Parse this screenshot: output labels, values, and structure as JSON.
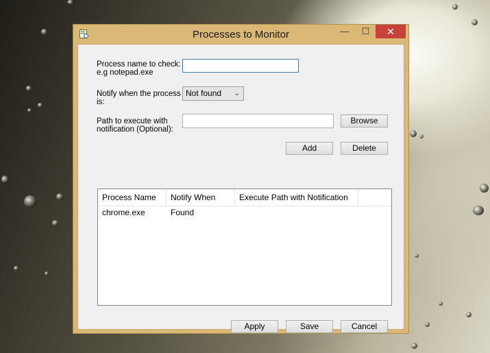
{
  "window": {
    "title": "Processes to Monitor",
    "controls": {
      "minimize": "—",
      "maximize": "☐",
      "close": "✕"
    }
  },
  "form": {
    "process_label": "Process name to check:",
    "process_hint": "e.g notepad.exe",
    "process_value": "",
    "notify_label_line1": "Notify when the process",
    "notify_label_line2": "is:",
    "notify_selected": "Not found",
    "path_label_line1": "Path to execute with",
    "path_label_line2": "notification (Optional):",
    "path_value": "",
    "browse_label": "Browse",
    "add_label": "Add",
    "delete_label": "Delete"
  },
  "list": {
    "columns": [
      "Process Name",
      "Notify When",
      "Execute Path with Notification"
    ],
    "rows": [
      {
        "process": "chrome.exe",
        "notify": "Found",
        "path": ""
      }
    ]
  },
  "footer": {
    "apply_label": "Apply",
    "save_label": "Save",
    "cancel_label": "Cancel"
  },
  "colors": {
    "frame": "#dcb877",
    "close_button": "#c7423b",
    "focus_border": "#3c7fb1"
  }
}
